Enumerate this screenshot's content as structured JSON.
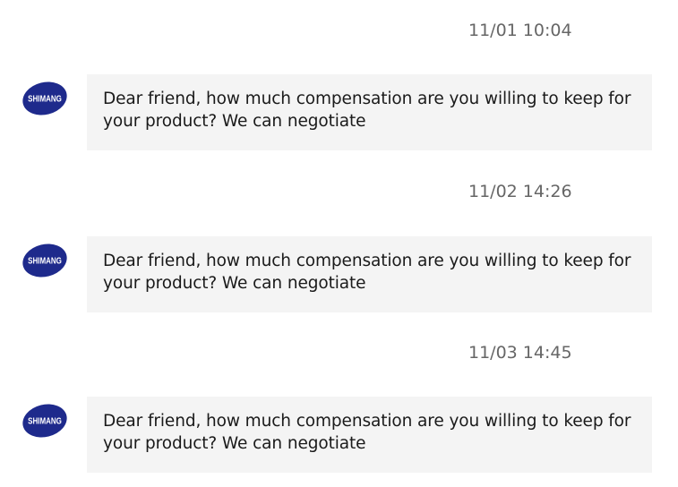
{
  "messages": [
    {
      "timestamp": "11/01 10:04",
      "avatar_label": "SHIMANG",
      "text": "Dear friend, how much compensation are you willing to keep for your product? We can negotiate"
    },
    {
      "timestamp": "11/02 14:26",
      "avatar_label": "SHIMANG",
      "text": "Dear friend, how much compensation are you willing to keep for your product? We can negotiate"
    },
    {
      "timestamp": "11/03 14:45",
      "avatar_label": "SHIMANG",
      "text": "Dear friend, how much compensation are you willing to keep for your product? We can negotiate"
    }
  ],
  "colors": {
    "avatar_bg": "#1e2a8c",
    "bubble_bg": "#f4f4f4",
    "timestamp": "#666666",
    "text": "#1a1a1a"
  },
  "icons": {
    "avatar": "shimang-logo-icon"
  }
}
